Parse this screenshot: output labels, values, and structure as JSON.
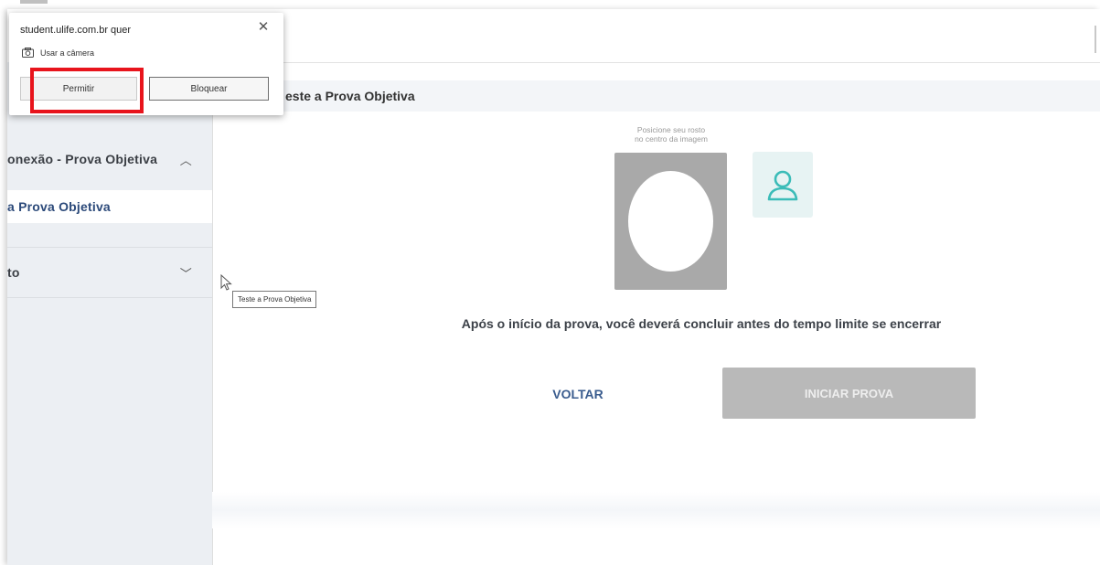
{
  "sidebar": {
    "section1": {
      "label": "onexão - Prova Objetiva",
      "chevron": "chevron-up-icon"
    },
    "active_item": {
      "label": "a Prova Objetiva"
    },
    "section2": {
      "label": "to",
      "chevron": "chevron-down-icon"
    }
  },
  "main": {
    "title": "este a Prova Objetiva",
    "face_hint_line1": "Posicione seu rosto",
    "face_hint_line2": "no centro da imagem",
    "notice": "Após o início da prova, você deverá concluir antes do tempo limite se encerrar",
    "back_button": "VOLTAR",
    "start_button": "INICIAR PROVA"
  },
  "tooltip": {
    "text": "Teste a Prova Objetiva"
  },
  "permission_popup": {
    "title": "student.ulife.com.br quer",
    "permission": "Usar a câmera",
    "allow_button": "Permitir",
    "block_button": "Bloquear",
    "icons": {
      "close": "close-icon",
      "camera": "camera-icon"
    }
  },
  "colors": {
    "highlight": "#e8141c",
    "link": "#3a5c8e",
    "start_disabled": "#b9b9b9",
    "avatar_accent": "#3bbcb8"
  }
}
